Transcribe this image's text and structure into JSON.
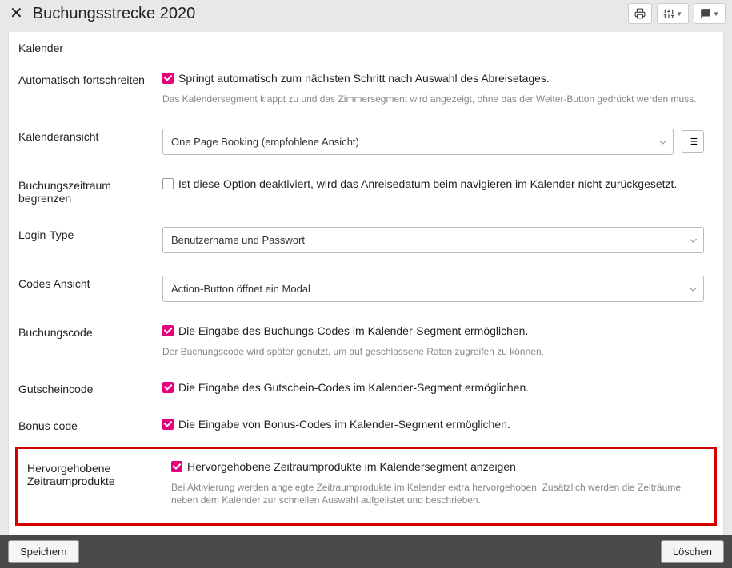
{
  "header": {
    "title": "Buchungsstrecke 2020"
  },
  "section": {
    "title": "Kalender"
  },
  "fields": {
    "autoAdvance": {
      "label": "Automatisch fortschreiten",
      "checkboxLabel": "Springt automatisch zum nächsten Schritt nach Auswahl des Abreisetages.",
      "help": "Das Kalendersegment klappt zu und das Zimmersegment wird angezeigt, ohne das der Weiter-Button gedrückt werden muss."
    },
    "calendarView": {
      "label": "Kalenderansicht",
      "selected": "One Page Booking (empfohlene Ansicht)"
    },
    "limitPeriod": {
      "label": "Buchungszeitraum begrenzen",
      "checkboxLabel": "Ist diese Option deaktiviert, wird das Anreisedatum beim navigieren im Kalender nicht zurückgesetzt."
    },
    "loginType": {
      "label": "Login-Type",
      "selected": "Benutzername und Passwort"
    },
    "codesView": {
      "label": "Codes Ansicht",
      "selected": "Action-Button öffnet ein Modal"
    },
    "bookingCode": {
      "label": "Buchungscode",
      "checkboxLabel": "Die Eingabe des Buchungs-Codes im Kalender-Segment ermöglichen.",
      "help": "Der Buchungscode wird später genutzt, um auf geschlossene Raten zugreifen zu können."
    },
    "voucherCode": {
      "label": "Gutscheincode",
      "checkboxLabel": "Die Eingabe des Gutschein-Codes im Kalender-Segment ermöglichen."
    },
    "bonusCode": {
      "label": "Bonus code",
      "checkboxLabel": "Die Eingabe von Bonus-Codes im Kalender-Segment ermöglichen."
    },
    "highlightedProducts": {
      "label": "Hervorgehobene Zeitraumprodukte",
      "checkboxLabel": "Hervorgehobene Zeitraumprodukte im Kalendersegment anzeigen",
      "help": "Bei Aktivierung werden angelegte Zeitraumprodukte im Kalender extra hervorgehoben. Zusätzlich werden die Zeiträume neben dem Kalender zur schnellen Auswahl aufgelistet und beschrieben."
    }
  },
  "footer": {
    "save": "Speichern",
    "delete": "Löschen"
  }
}
